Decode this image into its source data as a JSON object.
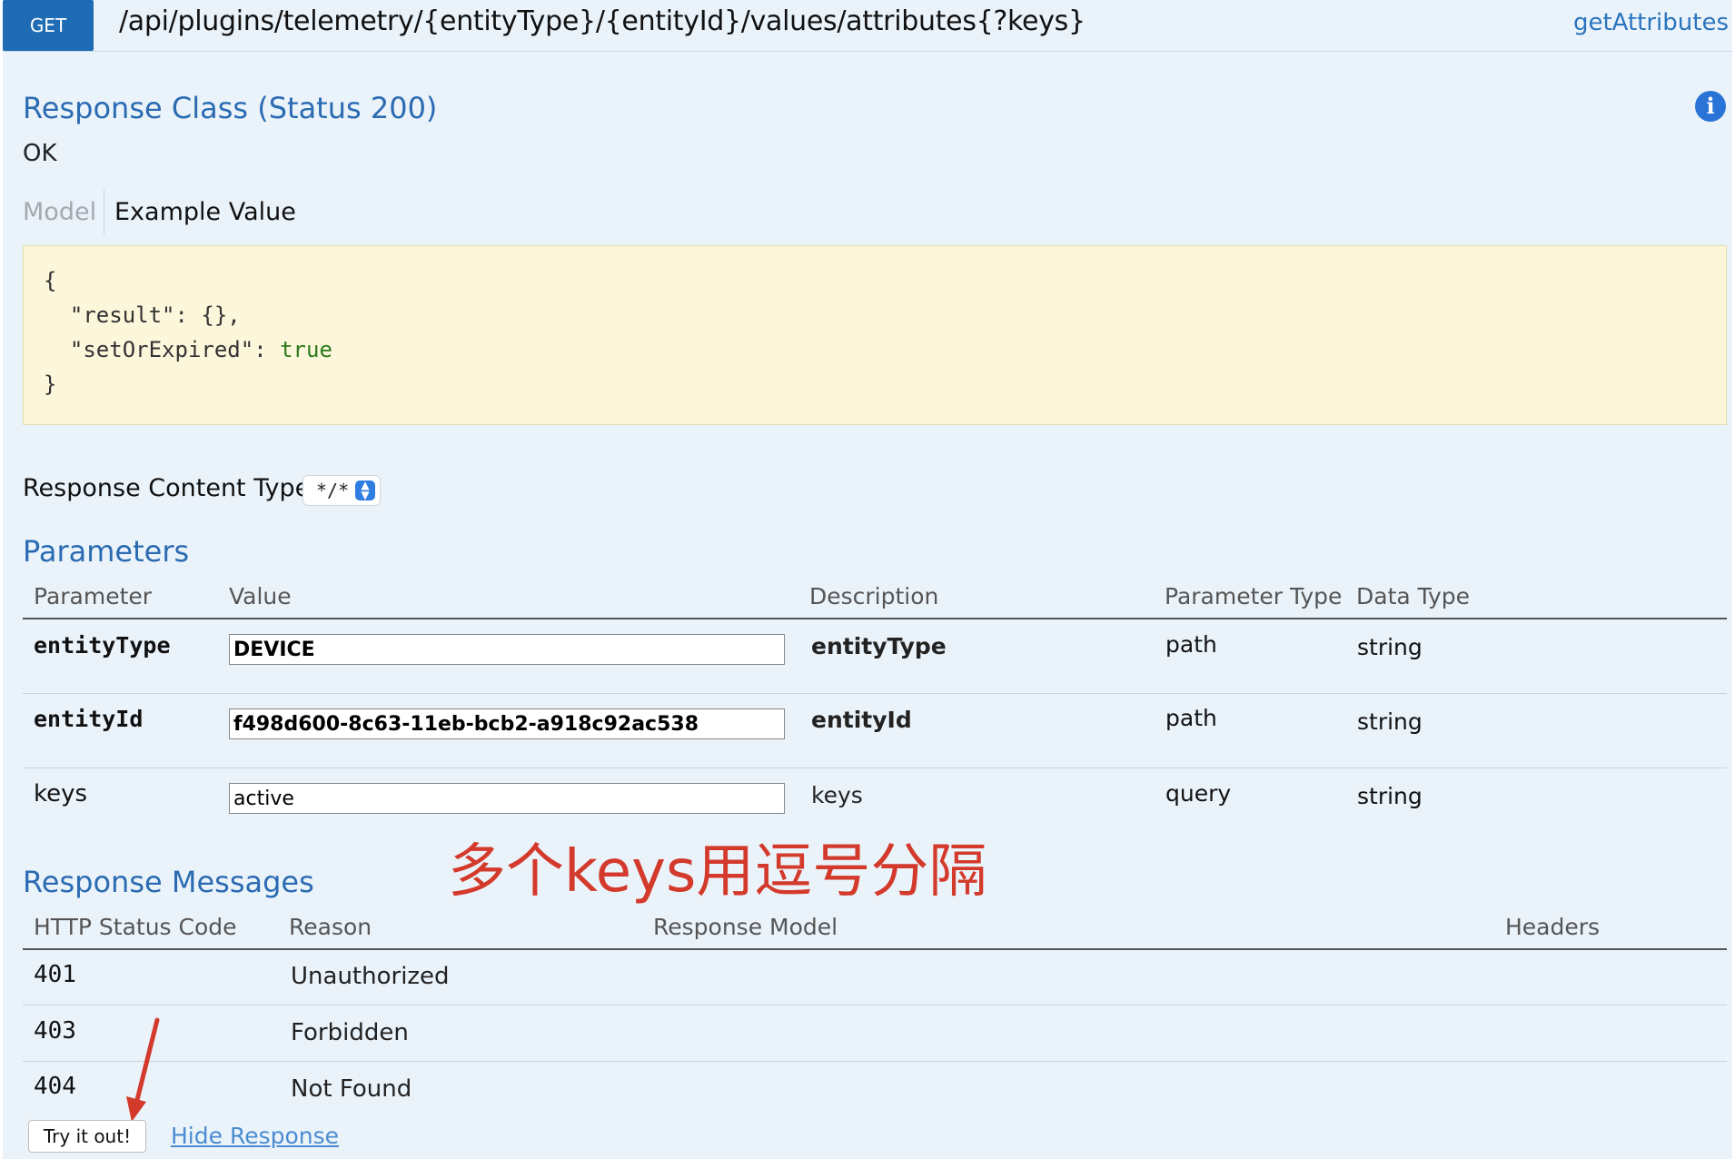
{
  "header": {
    "method": "GET",
    "path": "/api/plugins/telemetry/{entityType}/{entityId}/values/attributes{?keys}",
    "operation": "getAttributes"
  },
  "response_class": {
    "title": "Response Class (Status 200)",
    "status_text": "OK",
    "tabs": {
      "model": "Model",
      "example": "Example Value"
    },
    "example_lines": [
      "{",
      "  \"result\": {},",
      "  \"setOrExpired\": ",
      "}"
    ],
    "example_true": "true"
  },
  "content_type": {
    "label": "Response Content Type",
    "selected": "*/*"
  },
  "parameters": {
    "title": "Parameters",
    "columns": [
      "Parameter",
      "Value",
      "Description",
      "Parameter Type",
      "Data Type"
    ],
    "rows": [
      {
        "name": "entityType",
        "value": "DEVICE",
        "description": "entityType",
        "param_type": "path",
        "data_type": "string"
      },
      {
        "name": "entityId",
        "value": "f498d600-8c63-11eb-bcb2-a918c92ac538",
        "description": "entityId",
        "param_type": "path",
        "data_type": "string"
      },
      {
        "name": "keys",
        "value": "active",
        "description": "keys",
        "param_type": "query",
        "data_type": "string"
      }
    ]
  },
  "annotation": "多个keys用逗号分隔",
  "response_messages": {
    "title": "Response Messages",
    "columns": [
      "HTTP Status Code",
      "Reason",
      "Response Model",
      "Headers"
    ],
    "rows": [
      {
        "code": "401",
        "reason": "Unauthorized"
      },
      {
        "code": "403",
        "reason": "Forbidden"
      },
      {
        "code": "404",
        "reason": "Not Found"
      }
    ]
  },
  "actions": {
    "try_label": "Try it out!",
    "hide_label": "Hide Response"
  },
  "colors": {
    "method_bg": "#1f6cb4",
    "heading": "#2a6bb2",
    "annotation": "#d33a2c",
    "code_bg": "#fcf6db"
  }
}
